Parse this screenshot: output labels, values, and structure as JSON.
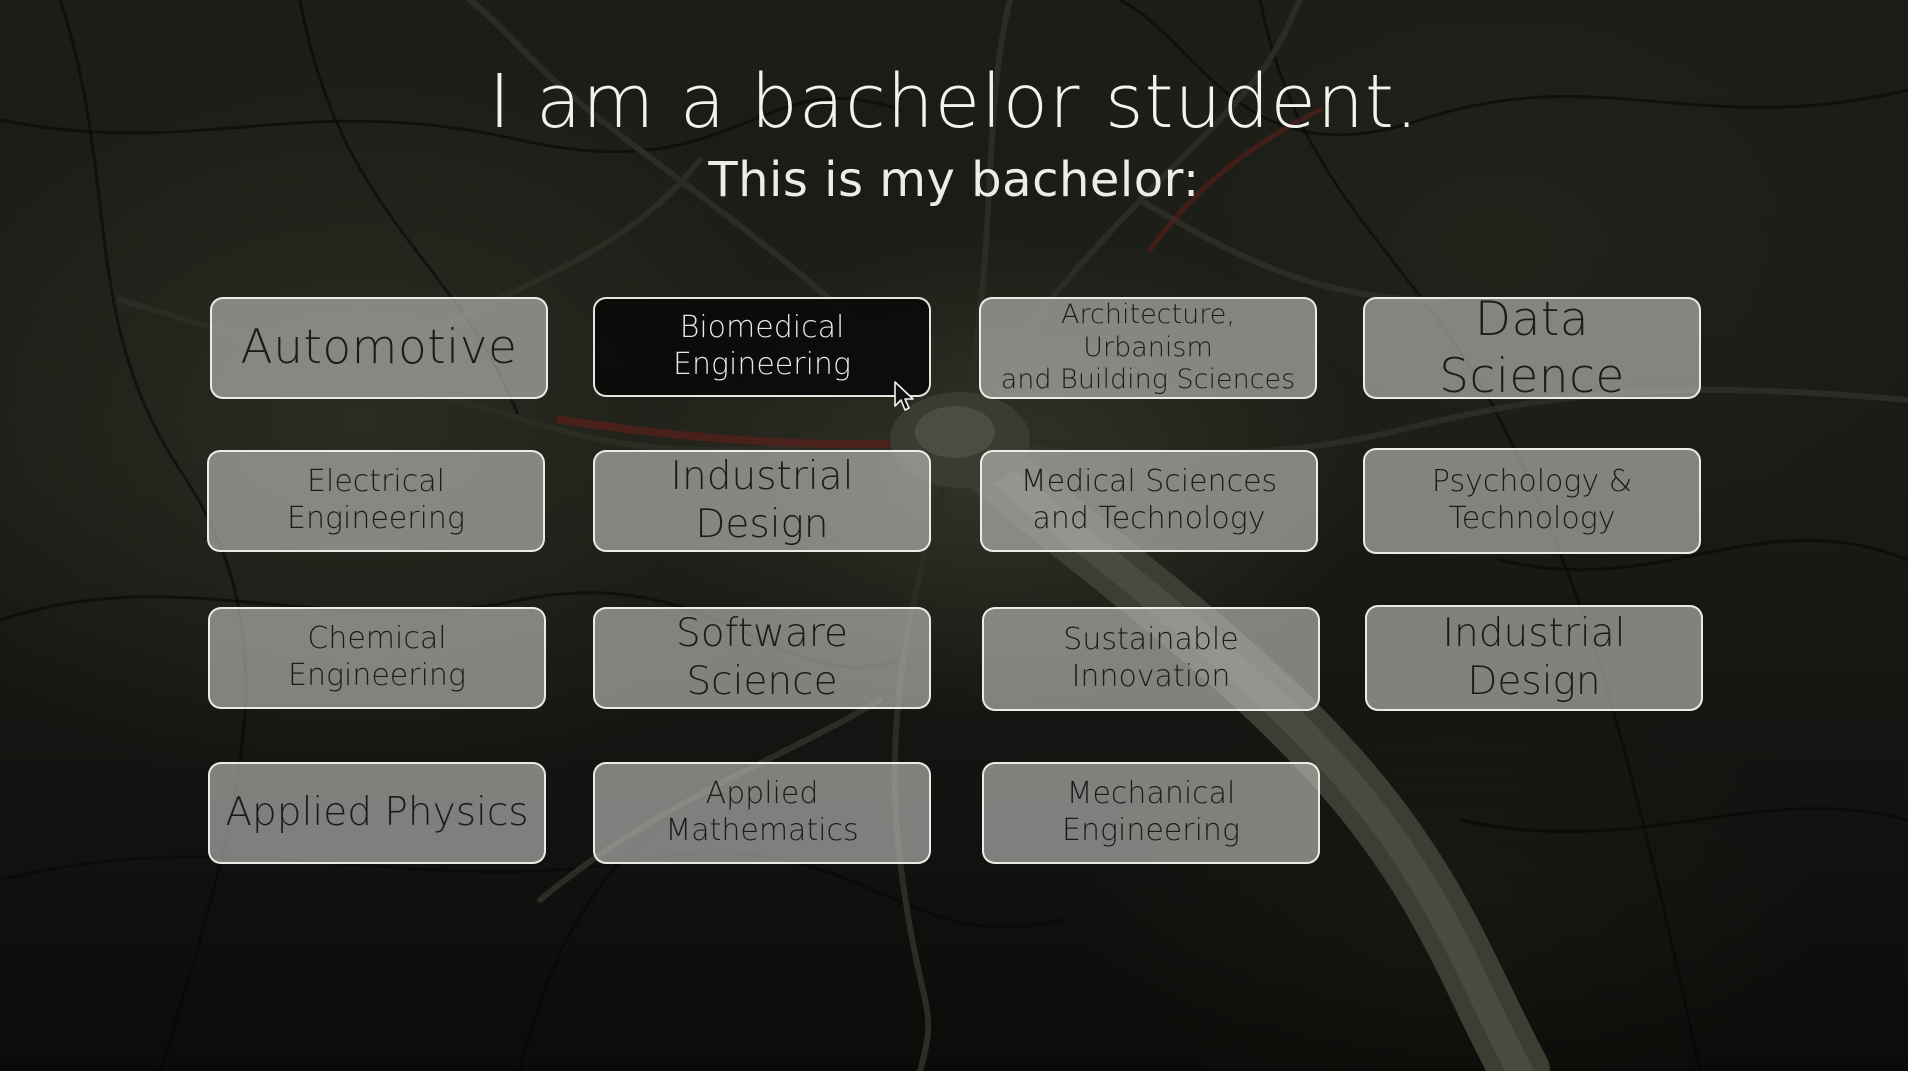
{
  "header": {
    "title": "I am a bachelor student.",
    "subtitle": "This is my bachelor:"
  },
  "programs": [
    "Automotive",
    "Biomedical\nEngineering",
    "Architecture, Urbanism\nand Building Sciences",
    "Data Science",
    "Electrical Engineering",
    "Industrial Design",
    "Medical Sciences\nand Technology",
    "Psychology &\nTechnology",
    "Chemical Engineering",
    "Software Science",
    "Sustainable\nInnovation",
    "Industrial Design",
    "Applied Physics",
    "Applied Mathematics",
    "Mechanical\nEngineering"
  ],
  "hovered_program": "Biomedical Engineering",
  "colors": {
    "tile_fill": "#c4c4c0",
    "tile_border": "#f5f5f0",
    "tile_hover_fill": "#080808",
    "title_text": "#f2f2ee"
  },
  "background_icon": "neuron-network-photo"
}
